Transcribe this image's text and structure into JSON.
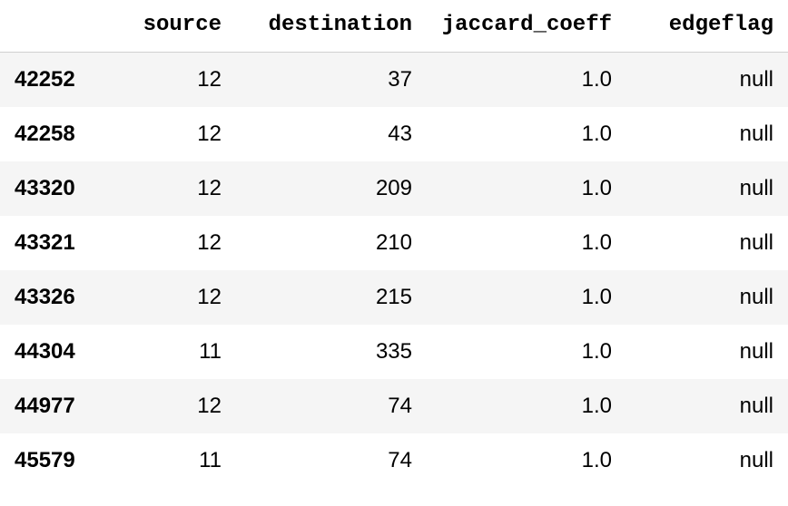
{
  "table": {
    "columns": [
      "source",
      "destination",
      "jaccard_coeff",
      "edgeflag"
    ],
    "rows": [
      {
        "index": "42252",
        "source": "12",
        "destination": "37",
        "jaccard_coeff": "1.0",
        "edgeflag": "null"
      },
      {
        "index": "42258",
        "source": "12",
        "destination": "43",
        "jaccard_coeff": "1.0",
        "edgeflag": "null"
      },
      {
        "index": "43320",
        "source": "12",
        "destination": "209",
        "jaccard_coeff": "1.0",
        "edgeflag": "null"
      },
      {
        "index": "43321",
        "source": "12",
        "destination": "210",
        "jaccard_coeff": "1.0",
        "edgeflag": "null"
      },
      {
        "index": "43326",
        "source": "12",
        "destination": "215",
        "jaccard_coeff": "1.0",
        "edgeflag": "null"
      },
      {
        "index": "44304",
        "source": "11",
        "destination": "335",
        "jaccard_coeff": "1.0",
        "edgeflag": "null"
      },
      {
        "index": "44977",
        "source": "12",
        "destination": "74",
        "jaccard_coeff": "1.0",
        "edgeflag": "null"
      },
      {
        "index": "45579",
        "source": "11",
        "destination": "74",
        "jaccard_coeff": "1.0",
        "edgeflag": "null"
      }
    ]
  }
}
